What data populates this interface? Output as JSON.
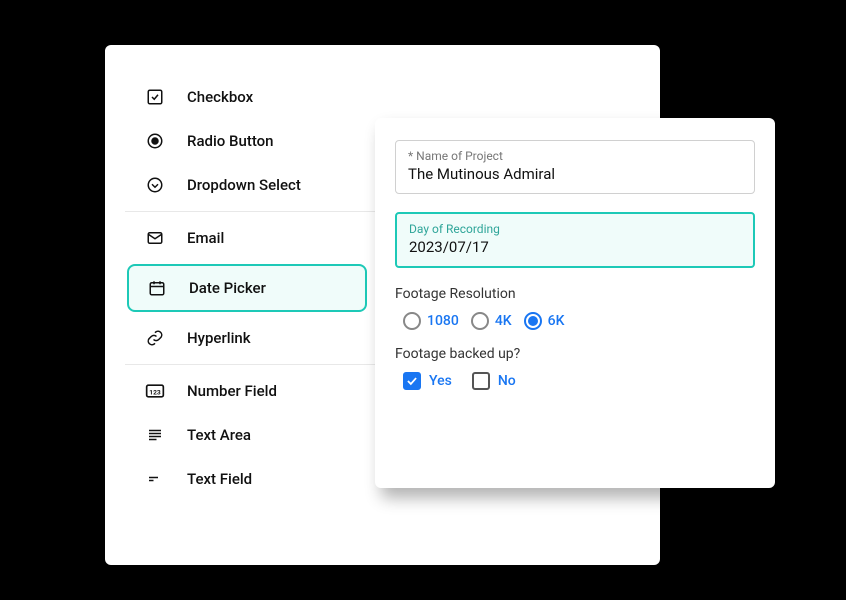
{
  "sidebar": {
    "items": [
      {
        "label": "Checkbox"
      },
      {
        "label": "Radio Button"
      },
      {
        "label": "Dropdown Select"
      },
      {
        "label": "Email"
      },
      {
        "label": "Date Picker"
      },
      {
        "label": "Hyperlink"
      },
      {
        "label": "Number Field"
      },
      {
        "label": "Text Area"
      },
      {
        "label": "Text Field"
      }
    ]
  },
  "form": {
    "project_name": {
      "label": "* Name of Project",
      "value": "The Mutinous Admiral"
    },
    "recording_day": {
      "label": "Day of Recording",
      "value": "2023/07/17"
    },
    "resolution": {
      "label": "Footage Resolution",
      "options": [
        "1080",
        "4K",
        "6K"
      ],
      "selected": "6K"
    },
    "backed_up": {
      "label": "Footage backed up?",
      "options": [
        "Yes",
        "No"
      ],
      "checked": [
        "Yes"
      ]
    }
  }
}
